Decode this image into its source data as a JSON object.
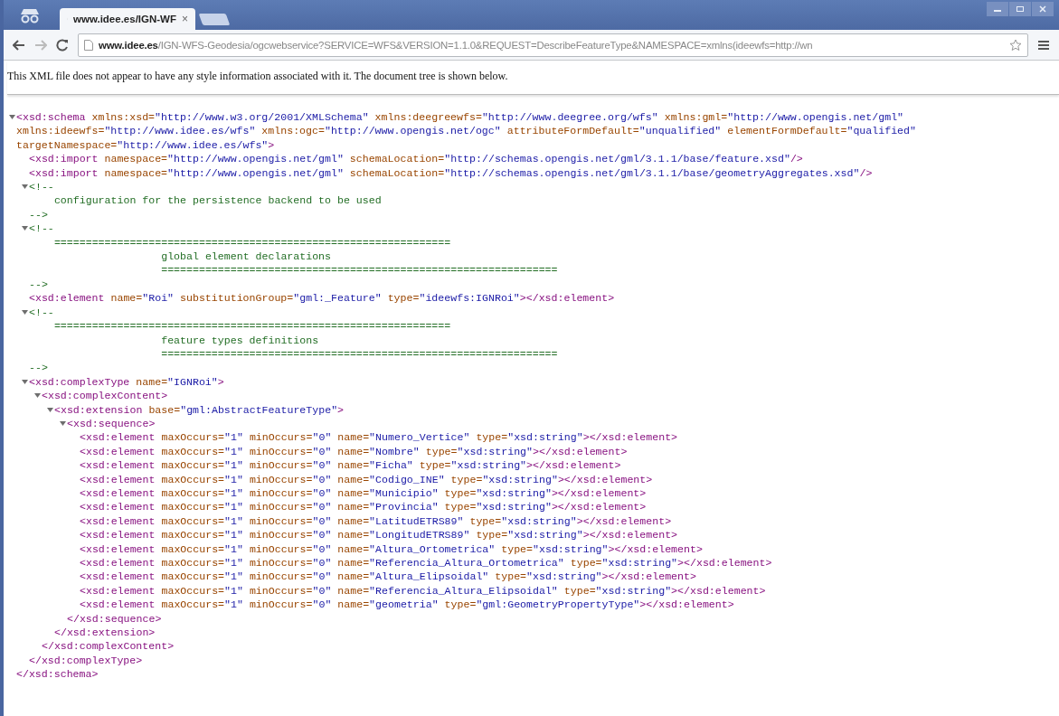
{
  "window": {
    "tabs": [
      {
        "title": "www.idee.es/IGN-WF",
        "close": "×",
        "selected": true
      }
    ],
    "address_bar": {
      "host": "www.idee.es",
      "path": "/IGN-WFS-Geodesia/ogcwebservice?SERVICE=WFS&VERSION=1.1.0&REQUEST=DescribeFeatureType&NAMESPACE=xmlns(ideewfs=http://wn"
    }
  },
  "notice": "This XML file does not appear to have any style information associated with it. The document tree is shown below.",
  "tree": [
    {
      "kind": "element",
      "expanded": true,
      "open": [
        {
          "tag": "<xsd:schema"
        },
        {
          "attr": "xmlns:xsd="
        },
        {
          "val": "\"http://www.w3.org/2001/XMLSchema\""
        },
        {
          "attr": "xmlns:deegreewfs="
        },
        {
          "val": "\"http://www.deegree.org/wfs\""
        },
        {
          "attr": "xmlns:gml="
        },
        {
          "val": "\"http://www.opengis.net/gml\""
        },
        {
          "attr": "xmlns:ideewfs="
        },
        {
          "val": "\"http://www.idee.es/wfs\""
        },
        {
          "attr": "xmlns:ogc="
        },
        {
          "val": "\"http://www.opengis.net/ogc\""
        },
        {
          "attr": "attributeFormDefault="
        },
        {
          "val": "\"unqualified\""
        },
        {
          "attr": "elementFormDefault="
        },
        {
          "val": "\"qualified\""
        },
        {
          "attr": "targetNamespace="
        },
        {
          "val": "\"http://www.idee.es/wfs\""
        },
        {
          "tag": ">"
        }
      ],
      "close": [
        {
          "tag": "</xsd:schema>"
        }
      ],
      "children": [
        {
          "kind": "leaf",
          "open": [
            {
              "tag": "<xsd:import"
            },
            {
              "attr": "namespace="
            },
            {
              "val": "\"http://www.opengis.net/gml\""
            },
            {
              "attr": "schemaLocation="
            },
            {
              "val": "\"http://schemas.opengis.net/gml/3.1.1/base/feature.xsd\""
            },
            {
              "tag": "/>"
            }
          ]
        },
        {
          "kind": "leaf",
          "open": [
            {
              "tag": "<xsd:import"
            },
            {
              "attr": "namespace="
            },
            {
              "val": "\"http://www.opengis.net/gml\""
            },
            {
              "attr": "schemaLocation="
            },
            {
              "val": "\"http://schemas.opengis.net/gml/3.1.1/base/geometryAggregates.xsd\""
            },
            {
              "tag": "/>"
            }
          ]
        },
        {
          "kind": "comment",
          "expanded": true,
          "open": [
            {
              "comment": "<!--"
            }
          ],
          "lines": [
            "  configuration for the persistence backend to be used"
          ],
          "close": [
            {
              "comment": "-->"
            }
          ]
        },
        {
          "kind": "comment",
          "expanded": true,
          "open": [
            {
              "comment": "<!--"
            }
          ],
          "lines": [
            "  ===============================================================",
            "                   global element declarations",
            "                   ==============================================================="
          ],
          "close": [
            {
              "comment": "-->"
            }
          ]
        },
        {
          "kind": "leaf",
          "open": [
            {
              "tag": "<xsd:element"
            },
            {
              "attr": "name="
            },
            {
              "val": "\"Roi\""
            },
            {
              "attr": "substitutionGroup="
            },
            {
              "val": "\"gml:_Feature\""
            },
            {
              "attr": "type="
            },
            {
              "val": "\"ideewfs:IGNRoi\""
            },
            {
              "tag": "></xsd:element>"
            }
          ]
        },
        {
          "kind": "comment",
          "expanded": true,
          "open": [
            {
              "comment": "<!--"
            }
          ],
          "lines": [
            "  ===============================================================",
            "                   feature types definitions",
            "                   ==============================================================="
          ],
          "close": [
            {
              "comment": "-->"
            }
          ]
        },
        {
          "kind": "element",
          "expanded": true,
          "open": [
            {
              "tag": "<xsd:complexType"
            },
            {
              "attr": "name="
            },
            {
              "val": "\"IGNRoi\""
            },
            {
              "tag": ">"
            }
          ],
          "close": [
            {
              "tag": "</xsd:complexType>"
            }
          ],
          "children": [
            {
              "kind": "element",
              "expanded": true,
              "open": [
                {
                  "tag": "<xsd:complexContent>"
                }
              ],
              "close": [
                {
                  "tag": "</xsd:complexContent>"
                }
              ],
              "children": [
                {
                  "kind": "element",
                  "expanded": true,
                  "open": [
                    {
                      "tag": "<xsd:extension"
                    },
                    {
                      "attr": "base="
                    },
                    {
                      "val": "\"gml:AbstractFeatureType\""
                    },
                    {
                      "tag": ">"
                    }
                  ],
                  "close": [
                    {
                      "tag": "</xsd:extension>"
                    }
                  ],
                  "children": [
                    {
                      "kind": "element",
                      "expanded": true,
                      "open": [
                        {
                          "tag": "<xsd:sequence>"
                        }
                      ],
                      "close": [
                        {
                          "tag": "</xsd:sequence>"
                        }
                      ],
                      "children": [
                        {
                          "kind": "leaf",
                          "open": [
                            {
                              "tag": "<xsd:element"
                            },
                            {
                              "attr": "maxOccurs="
                            },
                            {
                              "val": "\"1\""
                            },
                            {
                              "attr": "minOccurs="
                            },
                            {
                              "val": "\"0\""
                            },
                            {
                              "attr": "name="
                            },
                            {
                              "val": "\"Numero_Vertice\""
                            },
                            {
                              "attr": "type="
                            },
                            {
                              "val": "\"xsd:string\""
                            },
                            {
                              "tag": "></xsd:element>"
                            }
                          ]
                        },
                        {
                          "kind": "leaf",
                          "open": [
                            {
                              "tag": "<xsd:element"
                            },
                            {
                              "attr": "maxOccurs="
                            },
                            {
                              "val": "\"1\""
                            },
                            {
                              "attr": "minOccurs="
                            },
                            {
                              "val": "\"0\""
                            },
                            {
                              "attr": "name="
                            },
                            {
                              "val": "\"Nombre\""
                            },
                            {
                              "attr": "type="
                            },
                            {
                              "val": "\"xsd:string\""
                            },
                            {
                              "tag": "></xsd:element>"
                            }
                          ]
                        },
                        {
                          "kind": "leaf",
                          "open": [
                            {
                              "tag": "<xsd:element"
                            },
                            {
                              "attr": "maxOccurs="
                            },
                            {
                              "val": "\"1\""
                            },
                            {
                              "attr": "minOccurs="
                            },
                            {
                              "val": "\"0\""
                            },
                            {
                              "attr": "name="
                            },
                            {
                              "val": "\"Ficha\""
                            },
                            {
                              "attr": "type="
                            },
                            {
                              "val": "\"xsd:string\""
                            },
                            {
                              "tag": "></xsd:element>"
                            }
                          ]
                        },
                        {
                          "kind": "leaf",
                          "open": [
                            {
                              "tag": "<xsd:element"
                            },
                            {
                              "attr": "maxOccurs="
                            },
                            {
                              "val": "\"1\""
                            },
                            {
                              "attr": "minOccurs="
                            },
                            {
                              "val": "\"0\""
                            },
                            {
                              "attr": "name="
                            },
                            {
                              "val": "\"Codigo_INE\""
                            },
                            {
                              "attr": "type="
                            },
                            {
                              "val": "\"xsd:string\""
                            },
                            {
                              "tag": "></xsd:element>"
                            }
                          ]
                        },
                        {
                          "kind": "leaf",
                          "open": [
                            {
                              "tag": "<xsd:element"
                            },
                            {
                              "attr": "maxOccurs="
                            },
                            {
                              "val": "\"1\""
                            },
                            {
                              "attr": "minOccurs="
                            },
                            {
                              "val": "\"0\""
                            },
                            {
                              "attr": "name="
                            },
                            {
                              "val": "\"Municipio\""
                            },
                            {
                              "attr": "type="
                            },
                            {
                              "val": "\"xsd:string\""
                            },
                            {
                              "tag": "></xsd:element>"
                            }
                          ]
                        },
                        {
                          "kind": "leaf",
                          "open": [
                            {
                              "tag": "<xsd:element"
                            },
                            {
                              "attr": "maxOccurs="
                            },
                            {
                              "val": "\"1\""
                            },
                            {
                              "attr": "minOccurs="
                            },
                            {
                              "val": "\"0\""
                            },
                            {
                              "attr": "name="
                            },
                            {
                              "val": "\"Provincia\""
                            },
                            {
                              "attr": "type="
                            },
                            {
                              "val": "\"xsd:string\""
                            },
                            {
                              "tag": "></xsd:element>"
                            }
                          ]
                        },
                        {
                          "kind": "leaf",
                          "open": [
                            {
                              "tag": "<xsd:element"
                            },
                            {
                              "attr": "maxOccurs="
                            },
                            {
                              "val": "\"1\""
                            },
                            {
                              "attr": "minOccurs="
                            },
                            {
                              "val": "\"0\""
                            },
                            {
                              "attr": "name="
                            },
                            {
                              "val": "\"LatitudETRS89\""
                            },
                            {
                              "attr": "type="
                            },
                            {
                              "val": "\"xsd:string\""
                            },
                            {
                              "tag": "></xsd:element>"
                            }
                          ]
                        },
                        {
                          "kind": "leaf",
                          "open": [
                            {
                              "tag": "<xsd:element"
                            },
                            {
                              "attr": "maxOccurs="
                            },
                            {
                              "val": "\"1\""
                            },
                            {
                              "attr": "minOccurs="
                            },
                            {
                              "val": "\"0\""
                            },
                            {
                              "attr": "name="
                            },
                            {
                              "val": "\"LongitudETRS89\""
                            },
                            {
                              "attr": "type="
                            },
                            {
                              "val": "\"xsd:string\""
                            },
                            {
                              "tag": "></xsd:element>"
                            }
                          ]
                        },
                        {
                          "kind": "leaf",
                          "open": [
                            {
                              "tag": "<xsd:element"
                            },
                            {
                              "attr": "maxOccurs="
                            },
                            {
                              "val": "\"1\""
                            },
                            {
                              "attr": "minOccurs="
                            },
                            {
                              "val": "\"0\""
                            },
                            {
                              "attr": "name="
                            },
                            {
                              "val": "\"Altura_Ortometrica\""
                            },
                            {
                              "attr": "type="
                            },
                            {
                              "val": "\"xsd:string\""
                            },
                            {
                              "tag": "></xsd:element>"
                            }
                          ]
                        },
                        {
                          "kind": "leaf",
                          "open": [
                            {
                              "tag": "<xsd:element"
                            },
                            {
                              "attr": "maxOccurs="
                            },
                            {
                              "val": "\"1\""
                            },
                            {
                              "attr": "minOccurs="
                            },
                            {
                              "val": "\"0\""
                            },
                            {
                              "attr": "name="
                            },
                            {
                              "val": "\"Referencia_Altura_Ortometrica\""
                            },
                            {
                              "attr": "type="
                            },
                            {
                              "val": "\"xsd:string\""
                            },
                            {
                              "tag": "></xsd:element>"
                            }
                          ]
                        },
                        {
                          "kind": "leaf",
                          "open": [
                            {
                              "tag": "<xsd:element"
                            },
                            {
                              "attr": "maxOccurs="
                            },
                            {
                              "val": "\"1\""
                            },
                            {
                              "attr": "minOccurs="
                            },
                            {
                              "val": "\"0\""
                            },
                            {
                              "attr": "name="
                            },
                            {
                              "val": "\"Altura_Elipsoidal\""
                            },
                            {
                              "attr": "type="
                            },
                            {
                              "val": "\"xsd:string\""
                            },
                            {
                              "tag": "></xsd:element>"
                            }
                          ]
                        },
                        {
                          "kind": "leaf",
                          "open": [
                            {
                              "tag": "<xsd:element"
                            },
                            {
                              "attr": "maxOccurs="
                            },
                            {
                              "val": "\"1\""
                            },
                            {
                              "attr": "minOccurs="
                            },
                            {
                              "val": "\"0\""
                            },
                            {
                              "attr": "name="
                            },
                            {
                              "val": "\"Referencia_Altura_Elipsoidal\""
                            },
                            {
                              "attr": "type="
                            },
                            {
                              "val": "\"xsd:string\""
                            },
                            {
                              "tag": "></xsd:element>"
                            }
                          ]
                        },
                        {
                          "kind": "leaf",
                          "open": [
                            {
                              "tag": "<xsd:element"
                            },
                            {
                              "attr": "maxOccurs="
                            },
                            {
                              "val": "\"1\""
                            },
                            {
                              "attr": "minOccurs="
                            },
                            {
                              "val": "\"0\""
                            },
                            {
                              "attr": "name="
                            },
                            {
                              "val": "\"geometria\""
                            },
                            {
                              "attr": "type="
                            },
                            {
                              "val": "\"gml:GeometryPropertyType\""
                            },
                            {
                              "tag": "></xsd:element>"
                            }
                          ]
                        }
                      ]
                    }
                  ]
                }
              ]
            }
          ]
        }
      ]
    }
  ]
}
